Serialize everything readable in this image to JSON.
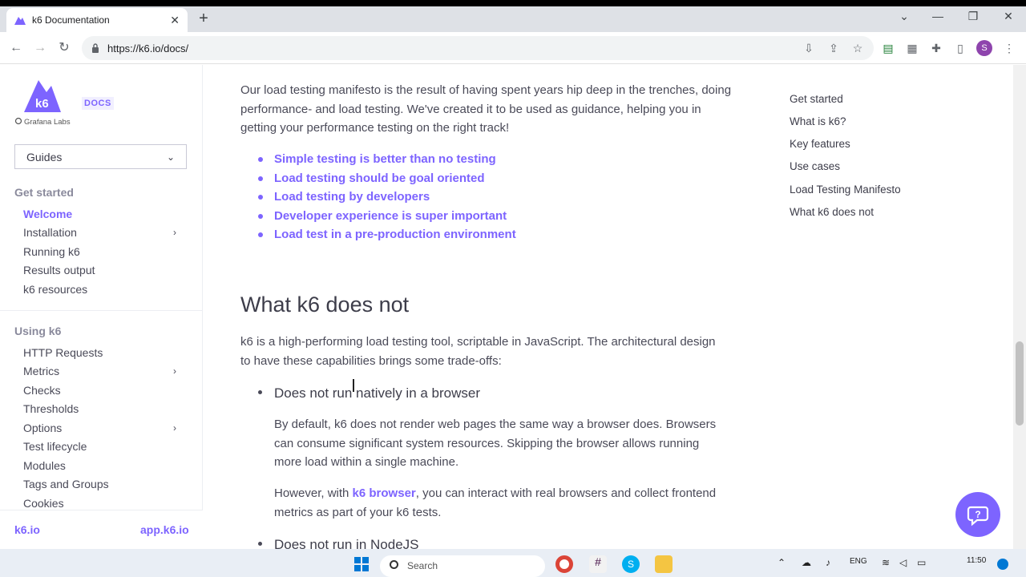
{
  "browser": {
    "tab_title": "k6 Documentation",
    "tab_close": "✕",
    "new_tab": "+",
    "url": "https://k6.io/docs/",
    "avatar_letter": "S"
  },
  "sidebar": {
    "logo_text": "k6",
    "logo_sub": "Grafana Labs",
    "docs_badge": "DOCS",
    "select_label": "Guides",
    "sections": [
      {
        "title": "Get started",
        "items": [
          {
            "label": "Welcome",
            "active": true
          },
          {
            "label": "Installation",
            "has_children": true
          },
          {
            "label": "Running k6"
          },
          {
            "label": "Results output"
          },
          {
            "label": "k6 resources"
          }
        ]
      },
      {
        "title": "Using k6",
        "items": [
          {
            "label": "HTTP Requests"
          },
          {
            "label": "Metrics",
            "has_children": true
          },
          {
            "label": "Checks"
          },
          {
            "label": "Thresholds"
          },
          {
            "label": "Options",
            "has_children": true
          },
          {
            "label": "Test lifecycle"
          },
          {
            "label": "Modules"
          },
          {
            "label": "Tags and Groups"
          },
          {
            "label": "Cookies"
          }
        ]
      }
    ],
    "footer_left": "k6.io",
    "footer_right": "app.k6.io"
  },
  "content": {
    "manifesto_para": "Our load testing manifesto is the result of having spent years hip deep in the trenches, doing performance- and load testing. We've created it to be used as guidance, helping you in getting your performance testing on the right track!",
    "manifesto_list": [
      "Simple testing is better than no testing",
      "Load testing should be goal oriented",
      "Load testing by developers",
      "Developer experience is super important",
      "Load test in a pre-production environment"
    ],
    "h2": "What k6 does not",
    "intro_para": "k6 is a high-performing load testing tool, scriptable in JavaScript. The architectural design to have these capabilities brings some trade-offs:",
    "point1_title": "Does not run natively in a browser",
    "point1_para": "By default, k6 does not render web pages the same way a browser does. Browsers can consume significant system resources. Skipping the browser allows running more load within a single machine.",
    "point1_para2_before": "However, with ",
    "point1_para2_link": "k6 browser",
    "point1_para2_after": ", you can interact with real browsers and collect frontend metrics as part of your k6 tests.",
    "point2_title": "Does not run in NodeJS"
  },
  "toc": {
    "items": [
      "Get started",
      "What is k6?",
      "Key features",
      "Use cases",
      "Load Testing Manifesto",
      "What k6 does not"
    ]
  },
  "taskbar": {
    "search_placeholder": "Search",
    "lang": "ENG",
    "time": "11:50"
  },
  "colors": {
    "accent": "#7d64ff",
    "text": "#4a4a58"
  }
}
